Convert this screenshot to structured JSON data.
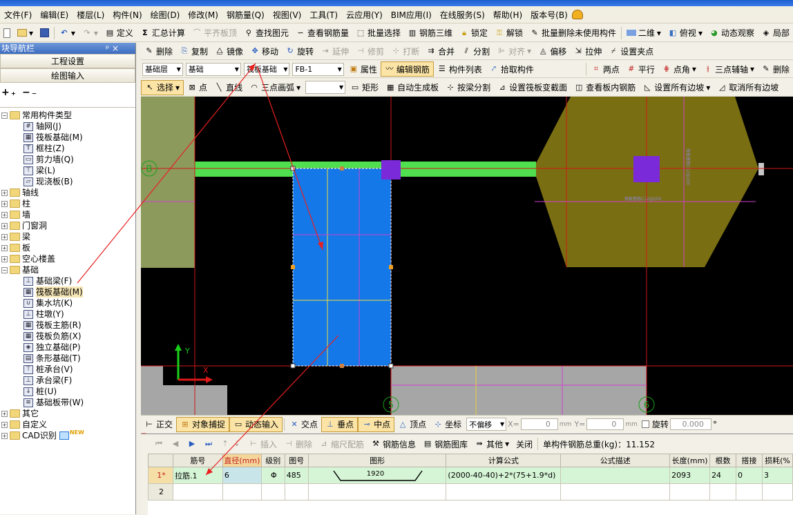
{
  "menu": [
    "文件(F)",
    "编辑(E)",
    "楼层(L)",
    "构件(N)",
    "绘图(D)",
    "修改(M)",
    "钢筋量(Q)",
    "视图(V)",
    "工具(T)",
    "云应用(Y)",
    "BIM应用(I)",
    "在线服务(S)",
    "帮助(H)",
    "版本号(B)"
  ],
  "toolbar1": {
    "define": "定义",
    "sum": "汇总计算",
    "flat_top": "平齐板顶",
    "find": "查找图元",
    "view_rebar": "查看钢筋量",
    "batch_select": "批量选择",
    "rebar_3d": "钢筋三维",
    "lock": "锁定",
    "unlock": "解锁",
    "batch_delete": "批量删除未使用构件",
    "view_2d": "二维",
    "top_view": "俯视",
    "dynamic": "动态观察",
    "local": "局部"
  },
  "sidebar": {
    "title": "块导航栏",
    "pin": "ᵖ ×",
    "btn_project": "工程设置",
    "btn_draw": "绘图输入",
    "tree": [
      {
        "level": 0,
        "exp": "−",
        "label": "常用构件类型",
        "type": "folder"
      },
      {
        "level": 1,
        "label": "轴网(J)",
        "type": "item",
        "icon": "#"
      },
      {
        "level": 1,
        "label": "筏板基础(M)",
        "type": "item",
        "icon": "▦"
      },
      {
        "level": 1,
        "label": "框柱(Z)",
        "type": "item",
        "icon": "T"
      },
      {
        "level": 1,
        "label": "剪力墙(Q)",
        "type": "item",
        "icon": "▭"
      },
      {
        "level": 1,
        "label": "梁(L)",
        "type": "item",
        "icon": "⊤"
      },
      {
        "level": 1,
        "label": "现浇板(B)",
        "type": "item",
        "icon": "▱"
      },
      {
        "level": 0,
        "exp": "+",
        "label": "轴线",
        "type": "folder"
      },
      {
        "level": 0,
        "exp": "+",
        "label": "柱",
        "type": "folder"
      },
      {
        "level": 0,
        "exp": "+",
        "label": "墙",
        "type": "folder"
      },
      {
        "level": 0,
        "exp": "+",
        "label": "门窗洞",
        "type": "folder"
      },
      {
        "level": 0,
        "exp": "+",
        "label": "梁",
        "type": "folder"
      },
      {
        "level": 0,
        "exp": "+",
        "label": "板",
        "type": "folder"
      },
      {
        "level": 0,
        "exp": "+",
        "label": "空心楼盖",
        "type": "folder"
      },
      {
        "level": 0,
        "exp": "−",
        "label": "基础",
        "type": "folder"
      },
      {
        "level": 1,
        "label": "基础梁(F)",
        "type": "item",
        "icon": "⊥"
      },
      {
        "level": 1,
        "label": "筏板基础(M)",
        "type": "item",
        "icon": "▦",
        "selected": true
      },
      {
        "level": 1,
        "label": "集水坑(K)",
        "type": "item",
        "icon": "∪"
      },
      {
        "level": 1,
        "label": "柱墩(Y)",
        "type": "item",
        "icon": "⊥"
      },
      {
        "level": 1,
        "label": "筏板主筋(R)",
        "type": "item",
        "icon": "▦"
      },
      {
        "level": 1,
        "label": "筏板负筋(X)",
        "type": "item",
        "icon": "▦"
      },
      {
        "level": 1,
        "label": "独立基础(P)",
        "type": "item",
        "icon": "◈"
      },
      {
        "level": 1,
        "label": "条形基础(T)",
        "type": "item",
        "icon": "▤"
      },
      {
        "level": 1,
        "label": "桩承台(V)",
        "type": "item",
        "icon": "⊤"
      },
      {
        "level": 1,
        "label": "承台梁(F)",
        "type": "item",
        "icon": "⊥"
      },
      {
        "level": 1,
        "label": "桩(U)",
        "type": "item",
        "icon": "↓"
      },
      {
        "level": 1,
        "label": "基础板带(W)",
        "type": "item",
        "icon": "≡"
      },
      {
        "level": 0,
        "exp": "+",
        "label": "其它",
        "type": "folder"
      },
      {
        "level": 0,
        "exp": "+",
        "label": "自定义",
        "type": "folder"
      },
      {
        "level": 0,
        "exp": "+",
        "label": "CAD识别",
        "type": "folder",
        "badge": "NEW"
      }
    ]
  },
  "edit_toolbar": {
    "delete": "删除",
    "copy": "复制",
    "mirror": "镜像",
    "move": "移动",
    "rotate": "旋转",
    "extend": "延伸",
    "trim": "修剪",
    "break": "打断",
    "merge": "合并",
    "split": "分割",
    "align": "对齐",
    "offset": "偏移",
    "stretch": "拉伸",
    "set_grip": "设置夹点"
  },
  "selector_toolbar": {
    "floor": "基础层",
    "category": "基础",
    "type": "筏板基础",
    "component": "FB-1",
    "properties": "属性",
    "edit_rebar": "编辑钢筋",
    "comp_list": "构件列表",
    "pick": "拾取构件",
    "two_point": "两点",
    "parallel": "平行",
    "point_angle": "点角",
    "three_aux": "三点辅轴",
    "del_aux": "删除"
  },
  "draw_toolbar": {
    "select": "选择",
    "point": "点",
    "line": "直线",
    "arc": "三点画弧",
    "rect": "矩形",
    "auto_gen": "自动生成板",
    "split_beam": "按梁分割",
    "set_slope": "设置筏板变截面",
    "view_inner": "查看板内钢筋",
    "set_edges": "设置所有边坡",
    "cancel_edges": "取消所有边坡"
  },
  "canvas": {
    "axis_labels": {
      "b": "B",
      "five": "5",
      "six": "6"
    },
    "ucs": {
      "y": "Y",
      "x": "X"
    },
    "hex_text_h": "筏板基筋C12@200",
    "hex_text_v": "筏板基筋C12@200"
  },
  "statusbar": {
    "ortho": "正交",
    "snap": "对象捕捉",
    "dyn_input": "动态输入",
    "intersect": "交点",
    "perp": "垂点",
    "mid": "中点",
    "vertex": "顶点",
    "coord": "坐标",
    "no_offset": "不偏移",
    "x_label": "X=",
    "x_val": "0",
    "mm1": "mm",
    "y_label": "Y=",
    "y_val": "0",
    "mm2": "mm",
    "rotate": "旋转",
    "rotate_val": "0.000",
    "deg": "°"
  },
  "rebar_toolbar": {
    "insert": "插入",
    "delete": "删除",
    "ruler": "缩尺配筋",
    "info": "钢筋信息",
    "lib": "钢筋图库",
    "other": "其他",
    "close": "关闭",
    "total": "单构件钢筋总重(kg)：11.152"
  },
  "rebar_table": {
    "headers": [
      "筋号",
      "直径(mm)",
      "级别",
      "图号",
      "图形",
      "计算公式",
      "公式描述",
      "长度(mm)",
      "根数",
      "搭接",
      "损耗(%"
    ],
    "rows": [
      {
        "row": "1*",
        "cells": [
          "拉筋.1",
          "6",
          "Φ",
          "485",
          "1920",
          "(2000-40-40)+2*(75+1.9*d)",
          "",
          "2093",
          "24",
          "0",
          "3"
        ]
      },
      {
        "row": "2",
        "cells": [
          "",
          "",
          "",
          "",
          "",
          "",
          "",
          "",
          "",
          "",
          ""
        ]
      }
    ]
  }
}
